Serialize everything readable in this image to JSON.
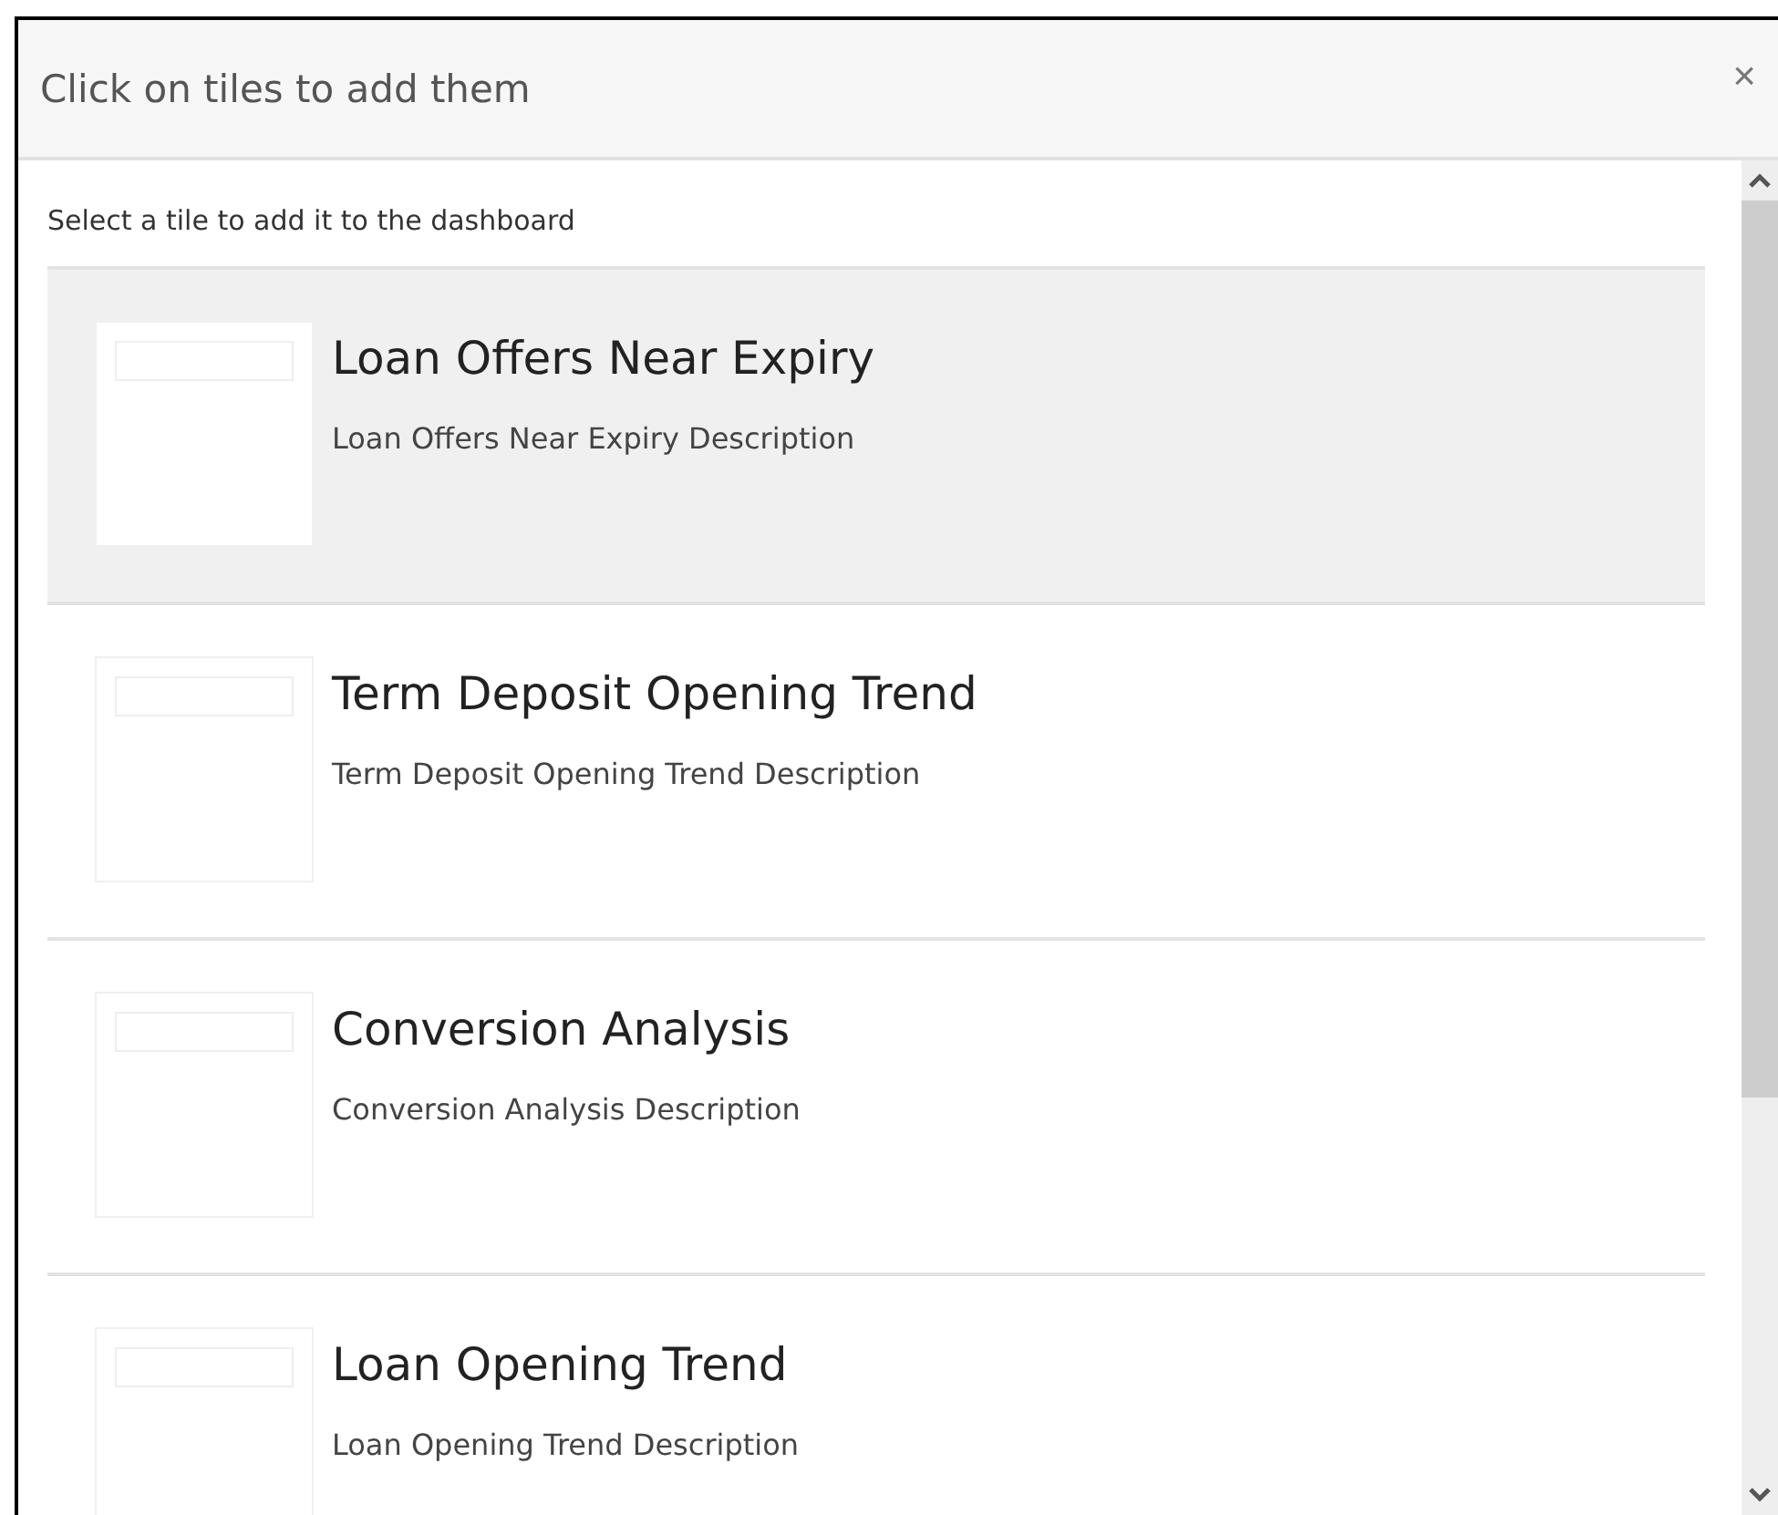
{
  "dialog": {
    "title": "Click on tiles to add them",
    "close": "×"
  },
  "intro": "Select a tile to add it to the dashboard",
  "tiles": [
    {
      "title": "Loan Offers Near Expiry",
      "description": "Loan Offers Near Expiry Description",
      "selected": true
    },
    {
      "title": "Term Deposit Opening Trend",
      "description": "Term Deposit Opening Trend Description",
      "selected": false
    },
    {
      "title": "Conversion Analysis",
      "description": "Conversion Analysis Description",
      "selected": false
    },
    {
      "title": "Loan Opening Trend",
      "description": "Loan Opening Trend Description",
      "selected": false
    }
  ]
}
